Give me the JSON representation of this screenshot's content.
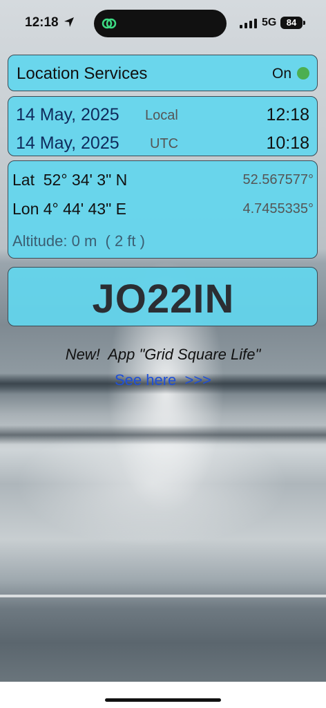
{
  "status_bar": {
    "time": "12:18",
    "network": "5G",
    "battery": "84"
  },
  "location_services": {
    "label": "Location Services",
    "state": "On",
    "state_color": "#4caf50"
  },
  "datetime": {
    "local": {
      "date": "14 May, 2025",
      "zone": "Local",
      "time": "12:18"
    },
    "utc": {
      "date": "14 May, 2025",
      "zone": "UTC",
      "time": "10:18"
    }
  },
  "position": {
    "lat_dms": "Lat  52° 34' 3\" N",
    "lat_decimal": "52.567577°",
    "lon_dms": "Lon 4° 44' 43\" E",
    "lon_decimal": "4.7455335°",
    "altitude": "Altitude: 0 m  ( 2 ft )"
  },
  "locator": "JO22IN",
  "promo": {
    "text": "New!  App \"Grid Square Life\"",
    "link": "See here  >>>"
  },
  "colors": {
    "panel": "#62d6ee",
    "link": "#1f4fd6",
    "date_text": "#0f2b5c"
  }
}
